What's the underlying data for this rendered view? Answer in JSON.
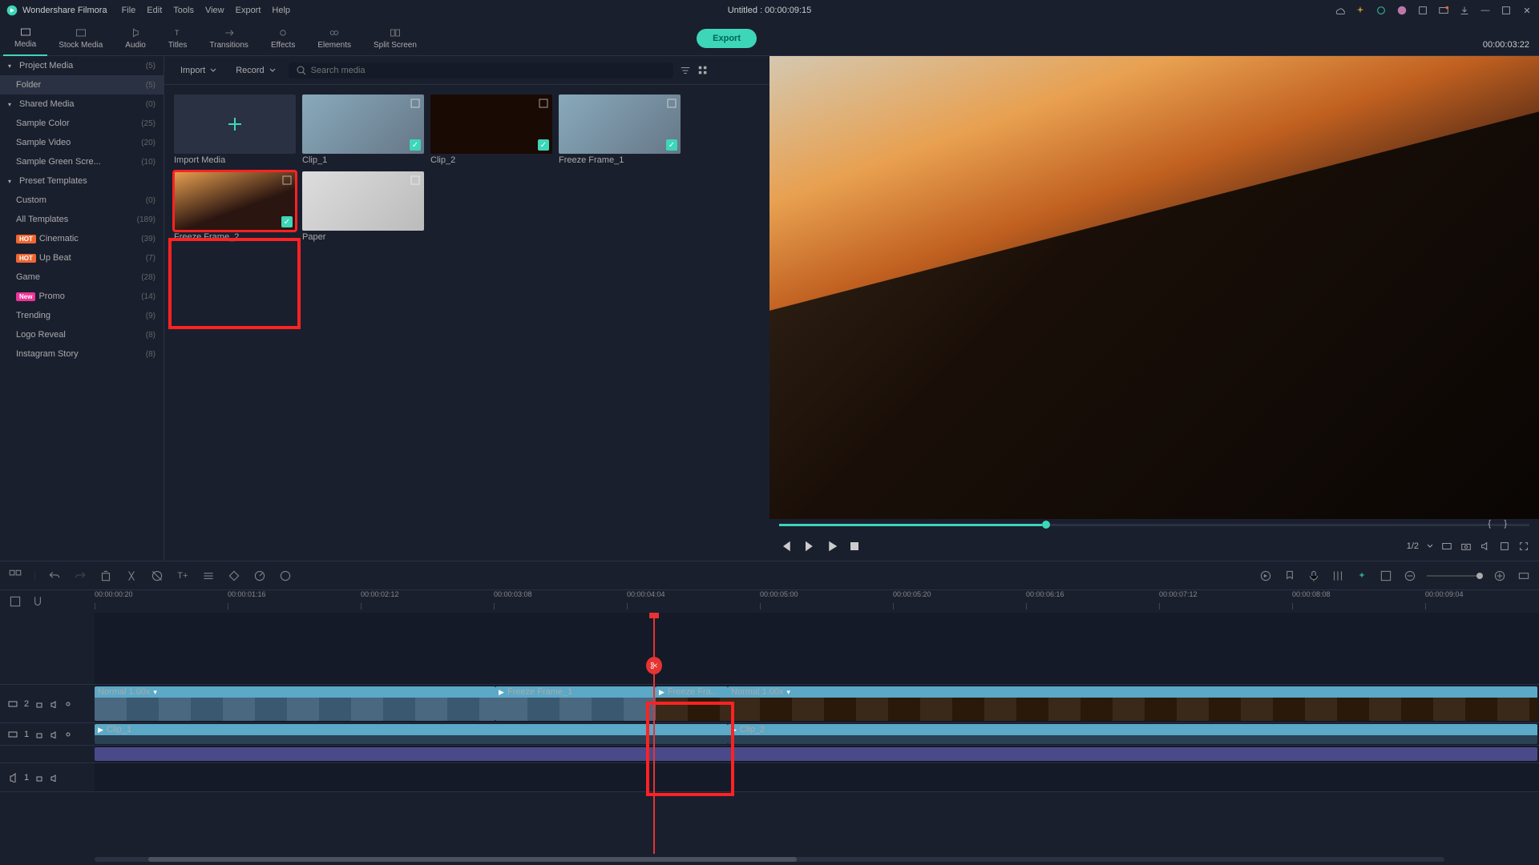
{
  "app": {
    "name": "Wondershare Filmora"
  },
  "menu": [
    "File",
    "Edit",
    "Tools",
    "View",
    "Export",
    "Help"
  ],
  "title": "Untitled : 00:00:09:15",
  "tabs": [
    {
      "label": "Media"
    },
    {
      "label": "Stock Media"
    },
    {
      "label": "Audio"
    },
    {
      "label": "Titles"
    },
    {
      "label": "Transitions"
    },
    {
      "label": "Effects"
    },
    {
      "label": "Elements"
    },
    {
      "label": "Split Screen"
    }
  ],
  "export_label": "Export",
  "sidebar": {
    "items": [
      {
        "name": "Project Media",
        "count": "(5)",
        "header": true
      },
      {
        "name": "Folder",
        "count": "(5)",
        "active": true
      },
      {
        "name": "Shared Media",
        "count": "(0)",
        "header": true
      },
      {
        "name": "Sample Color",
        "count": "(25)"
      },
      {
        "name": "Sample Video",
        "count": "(20)"
      },
      {
        "name": "Sample Green Scre...",
        "count": "(10)"
      },
      {
        "name": "Preset Templates",
        "count": "",
        "header": true
      },
      {
        "name": "Custom",
        "count": "(0)"
      },
      {
        "name": "All Templates",
        "count": "(189)"
      },
      {
        "name": "Cinematic",
        "count": "(39)",
        "badge": "HOT"
      },
      {
        "name": "Up Beat",
        "count": "(7)",
        "badge": "HOT"
      },
      {
        "name": "Game",
        "count": "(28)"
      },
      {
        "name": "Promo",
        "count": "(14)",
        "badge": "New"
      },
      {
        "name": "Trending",
        "count": "(9)"
      },
      {
        "name": "Logo Reveal",
        "count": "(8)"
      },
      {
        "name": "Instagram Story",
        "count": "(8)"
      }
    ]
  },
  "media_toolbar": {
    "import": "Import",
    "record": "Record",
    "search_placeholder": "Search media"
  },
  "media": {
    "import_label": "Import Media",
    "items": [
      {
        "name": "Clip_1",
        "checked": true,
        "bg": "linear-gradient(135deg,#8ab,#678)"
      },
      {
        "name": "Clip_2",
        "checked": true,
        "bg": "#1a0a04"
      },
      {
        "name": "Freeze Frame_1",
        "checked": true,
        "bg": "linear-gradient(135deg,#8ab,#678)"
      },
      {
        "name": "Freeze Frame_2",
        "checked": true,
        "selected": true,
        "bg": "linear-gradient(160deg,#e8a050,#2a1510 60%)"
      },
      {
        "name": "Paper",
        "checked": false,
        "bg": "linear-gradient(135deg,#ddd,#bbb)"
      }
    ]
  },
  "preview": {
    "time": "00:00:03:22",
    "zoom": "1/2"
  },
  "ruler": [
    "00:00:00:20",
    "00:00:01:16",
    "00:00:02:12",
    "00:00:03:08",
    "00:00:04:04",
    "00:00:05:00",
    "00:00:05:20",
    "00:00:06:16",
    "00:00:07:12",
    "00:00:08:08",
    "00:00:09:04"
  ],
  "tracks": {
    "t2": "2",
    "t1": "1",
    "a1": "1"
  },
  "clips": {
    "normal": "Normal 1.00x",
    "ff1": "Freeze Frame_1",
    "ff2": "Freeze Fra...",
    "c1": "Clip_1",
    "c2": "Clip_2"
  }
}
